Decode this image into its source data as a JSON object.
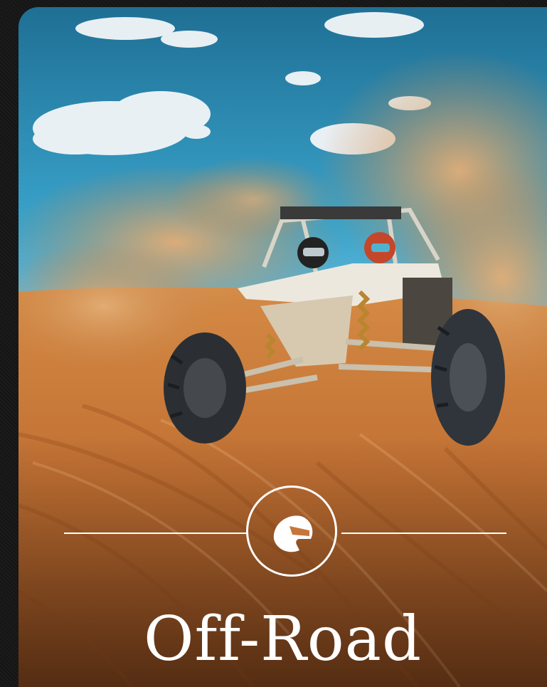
{
  "card": {
    "title": "Off-Road",
    "badge_icon": "helmet-icon",
    "colors": {
      "sky": "#2f8fb6",
      "sand": "#c8793c",
      "dust": "#d79a5f",
      "vehicle": "#e8e4da",
      "accent_line": "#ffffff"
    }
  }
}
